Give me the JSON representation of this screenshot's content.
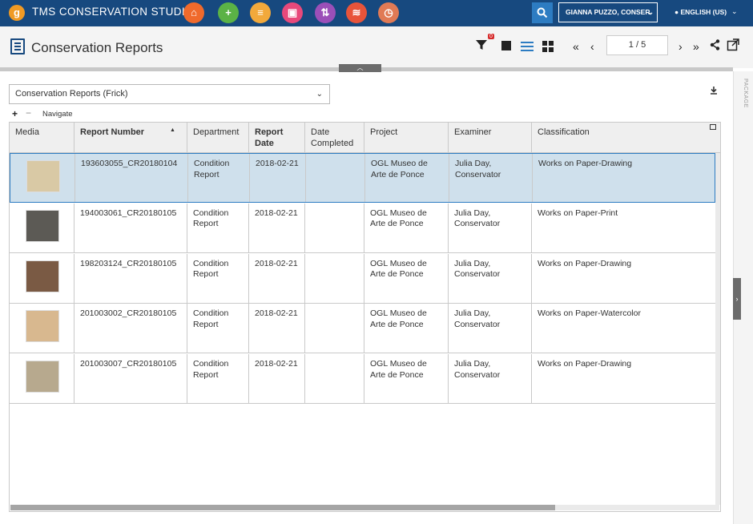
{
  "app": {
    "logo_letter": "g",
    "title": "TMS CONSERVATION STUDIO",
    "user": "GIANNA PUZZO, CONSER",
    "language": "ENGLISH (US)"
  },
  "colors": {
    "topbar": "#17497f",
    "accent": "#2d7cc2",
    "selected_row": "#cfe0ec",
    "filter_badge": "#d62b2b"
  },
  "app_icons": [
    {
      "name": "home-icon",
      "color": "#f06a2c",
      "glyph": "⌂"
    },
    {
      "name": "add-icon",
      "color": "#5bb246",
      "glyph": "+"
    },
    {
      "name": "notes-icon",
      "color": "#f2a93b",
      "glyph": "≡"
    },
    {
      "name": "media-icon",
      "color": "#e8497b",
      "glyph": "▣"
    },
    {
      "name": "transfer-icon",
      "color": "#9b4fb8",
      "glyph": "⇅"
    },
    {
      "name": "layers-icon",
      "color": "#e8543a",
      "glyph": "≋"
    },
    {
      "name": "history-icon",
      "color": "#e07a55",
      "glyph": "◷"
    }
  ],
  "header": {
    "title": "Conservation Reports",
    "filter_count": "0",
    "pager": "1 / 5"
  },
  "selector": {
    "value": "Conservation Reports (Frick)",
    "navigate_label": "Navigate"
  },
  "side_panel": {
    "label": "PACKAGE"
  },
  "table": {
    "columns": [
      "Media",
      "Report Number",
      "Department",
      "Report Date",
      "Date Completed",
      "Project",
      "Examiner",
      "Classification"
    ],
    "rows": [
      {
        "report_number": "193603055_CR20180104",
        "department": "Condition Report",
        "report_date": "2018-02-21",
        "date_completed": "",
        "project": "OGL Museo de Arte de Ponce",
        "examiner": "Julia Day, Conservator",
        "classification": "Works on Paper-Drawing",
        "thumb_color": "#d9c9a5"
      },
      {
        "report_number": "194003061_CR20180105",
        "department": "Condition Report",
        "report_date": "2018-02-21",
        "date_completed": "",
        "project": "OGL Museo de Arte de Ponce",
        "examiner": "Julia Day, Conservator",
        "classification": "Works on Paper-Print",
        "thumb_color": "#5c5a55"
      },
      {
        "report_number": "198203124_CR20180105",
        "department": "Condition Report",
        "report_date": "2018-02-21",
        "date_completed": "",
        "project": "OGL Museo de Arte de Ponce",
        "examiner": "Julia Day, Conservator",
        "classification": "Works on Paper-Drawing",
        "thumb_color": "#7a5a44"
      },
      {
        "report_number": "201003002_CR20180105",
        "department": "Condition Report",
        "report_date": "2018-02-21",
        "date_completed": "",
        "project": "OGL Museo de Arte de Ponce",
        "examiner": "Julia Day, Conservator",
        "classification": "Works on Paper-Watercolor",
        "thumb_color": "#d8b88f"
      },
      {
        "report_number": "201003007_CR20180105",
        "department": "Condition Report",
        "report_date": "2018-02-21",
        "date_completed": "",
        "project": "OGL Museo de Arte de Ponce",
        "examiner": "Julia Day, Conservator",
        "classification": "Works on Paper-Drawing",
        "thumb_color": "#b7a98e"
      }
    ]
  }
}
